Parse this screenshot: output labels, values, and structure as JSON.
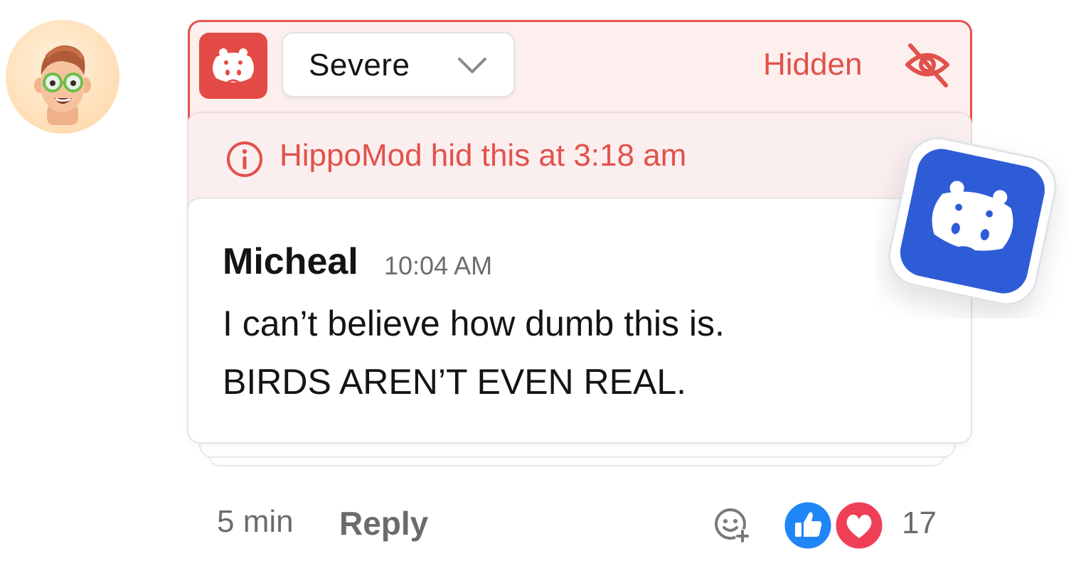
{
  "moderation": {
    "severity_value": "Severe",
    "status_label": "Hidden",
    "notice": "HippoMod hid this at 3:18 am",
    "accent_color": "#e4534d"
  },
  "comment": {
    "author": "Micheal",
    "time": "10:04 AM",
    "body_line1": "I can’t believe how dumb this is.",
    "body_line2": "BIRDS AREN’T EVEN REAL."
  },
  "footer": {
    "age": "5 min",
    "reply_label": "Reply",
    "reaction_count": "17"
  },
  "icons": {
    "avatar": "memoji-avatar",
    "mod_logo": "hippo-icon",
    "dropdown": "chevron-down-icon",
    "status": "eye-off-icon",
    "notice": "info-icon",
    "floating_logo": "hippo-icon",
    "add_reaction": "add-reaction-icon",
    "like": "thumbs-up-icon",
    "love": "heart-icon"
  },
  "colors": {
    "brand_blue": "#2f5bd6",
    "like_blue": "#1f86f5",
    "love_red": "#ef3f57"
  }
}
